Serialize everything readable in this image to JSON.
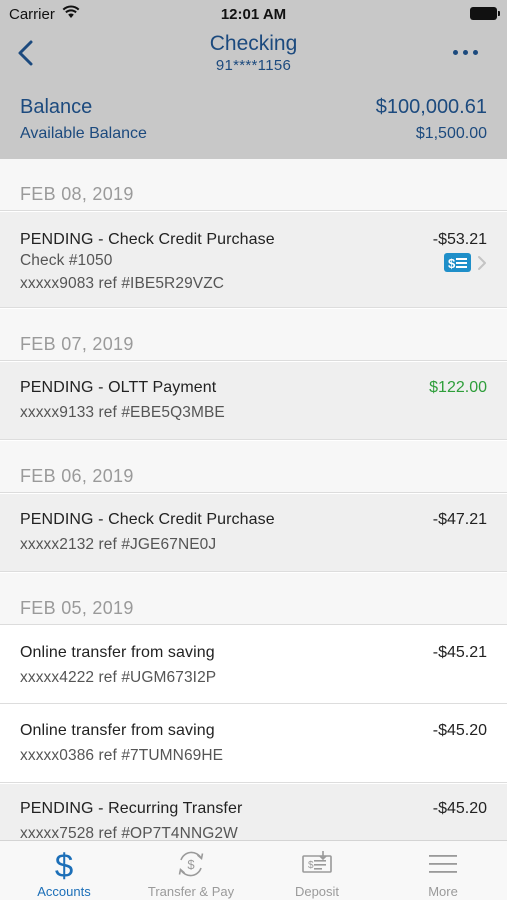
{
  "status_bar": {
    "carrier": "Carrier",
    "time": "12:01 AM"
  },
  "nav": {
    "title": "Checking",
    "account_number": "91****1156"
  },
  "balance": {
    "label": "Balance",
    "value": "$100,000.61",
    "available_label": "Available Balance",
    "available_value": "$1,500.00"
  },
  "groups": [
    {
      "date": "FEB 08, 2019",
      "transactions": [
        {
          "title": "PENDING - Check Credit Purchase",
          "check": "Check #1050",
          "ref": "xxxxx9083 ref #IBE5R29VZC",
          "amount": "-$53.21"
        }
      ]
    },
    {
      "date": "FEB 07, 2019",
      "transactions": [
        {
          "title": "PENDING - OLTT Payment",
          "ref": "xxxxx9133 ref #EBE5Q3MBE",
          "amount": "$122.00"
        }
      ]
    },
    {
      "date": "FEB 06, 2019",
      "transactions": [
        {
          "title": "PENDING - Check Credit Purchase",
          "ref": "xxxxx2132 ref #JGE67NE0J",
          "amount": "-$47.21"
        }
      ]
    },
    {
      "date": "FEB 05, 2019",
      "transactions": [
        {
          "title": "Online transfer from saving",
          "ref": "xxxxx4222 ref #UGM673I2P",
          "amount": "-$45.21"
        },
        {
          "title": "Online transfer from saving",
          "ref": "xxxxx0386 ref #7TUMN69HE",
          "amount": "-$45.20"
        },
        {
          "title": "PENDING - Recurring Transfer",
          "ref": "xxxxx7528 ref #OP7T4NNG2W",
          "amount": "-$45.20"
        }
      ]
    }
  ],
  "tabs": [
    {
      "label": "Accounts",
      "icon": "dollar-icon",
      "active": true
    },
    {
      "label": "Transfer & Pay",
      "icon": "transfer-cycle-icon",
      "active": false
    },
    {
      "label": "Deposit",
      "icon": "check-deposit-icon",
      "active": false
    },
    {
      "label": "More",
      "icon": "hamburger-menu-icon",
      "active": false
    }
  ],
  "colors": {
    "header_bg": "#c8c8c8",
    "brand_blue": "#1c4a7e",
    "tab_active": "#1c6fb8",
    "positive_amount": "#2e9e3a",
    "pending_row_bg": "#efefef",
    "check_icon": "#1f8fc9"
  }
}
